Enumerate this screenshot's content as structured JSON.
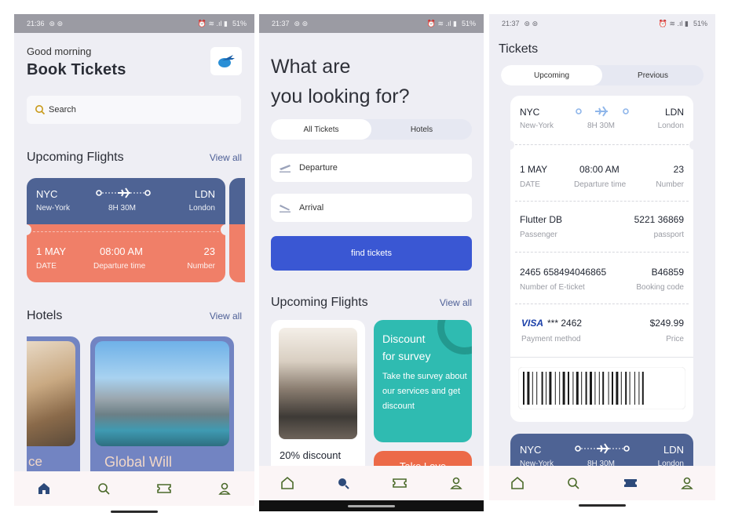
{
  "screen1": {
    "status": {
      "time": "21:36",
      "battery": "51%"
    },
    "greeting": "Good morning",
    "title": "Book Tickets",
    "search_placeholder": "Search",
    "upcoming_title": "Upcoming Flights",
    "upcoming_view_all": "View all",
    "flight": {
      "from_code": "NYC",
      "from_city": "New-York",
      "duration": "8H 30M",
      "to_code": "LDN",
      "to_city": "London",
      "date": "1 MAY",
      "date_label": "DATE",
      "time": "08:00 AM",
      "time_label": "Departure time",
      "number": "23",
      "number_label": "Number"
    },
    "hotels_title": "Hotels",
    "hotels_view_all": "View all",
    "hotel_card_1": "ce",
    "hotel_card_2": "Global Will"
  },
  "screen2": {
    "status": {
      "time": "21:37",
      "battery": "51%"
    },
    "title_line1": "What are",
    "title_line2": "you looking for?",
    "tab_all": "All Tickets",
    "tab_hotels": "Hotels",
    "departure_placeholder": "Departure",
    "arrival_placeholder": "Arrival",
    "find_button": "find tickets",
    "upcoming_title": "Upcoming Flights",
    "upcoming_view_all": "View all",
    "promo_text": "20% discount",
    "discount_title_1": "Discount",
    "discount_title_2": "for survey",
    "discount_body": "Take the survey about our services and get discount",
    "orange_title": "Take Love"
  },
  "screen3": {
    "status": {
      "time": "21:37",
      "battery": "51%"
    },
    "title": "Tickets",
    "tab_upcoming": "Upcoming",
    "tab_previous": "Previous",
    "ticket": {
      "from_code": "NYC",
      "from_city": "New-York",
      "duration": "8H 30M",
      "to_code": "LDN",
      "to_city": "London",
      "date": "1 MAY",
      "date_label": "DATE",
      "time": "08:00 AM",
      "time_label": "Departure time",
      "number": "23",
      "number_label": "Number",
      "passenger": "Flutter DB",
      "passenger_label": "Passenger",
      "passport": "5221 36869",
      "passport_label": "passport",
      "eticket": "2465 658494046865",
      "eticket_label": "Number of E-ticket",
      "booking": "B46859",
      "booking_label": "Booking code",
      "card_brand": "VISA",
      "card_number": "*** 2462",
      "payment_label": "Payment method",
      "price": "$249.99",
      "price_label": "Price"
    },
    "next_ticket": {
      "from_code": "NYC",
      "from_city": "New-York",
      "duration": "8H 30M",
      "to_code": "LDN",
      "to_city": "London"
    }
  },
  "colors": {
    "ticket_blue": "#4e6394",
    "ticket_orange": "#f07f68",
    "button_blue": "#3a57d3",
    "teal": "#2fbbb1",
    "nav_icon": "#4b6a2a"
  }
}
